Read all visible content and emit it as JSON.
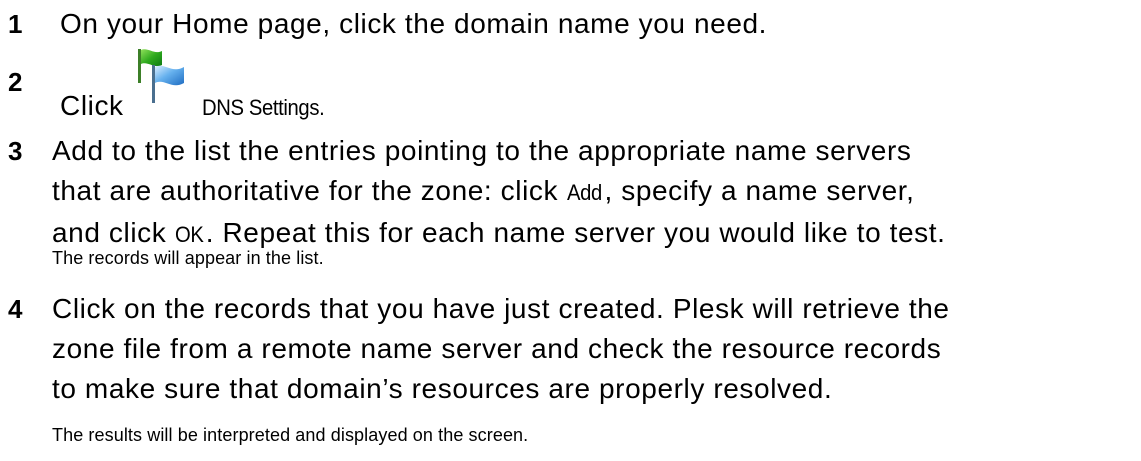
{
  "steps": [
    {
      "number": "1",
      "text": "On your Home page, click the domain name you need."
    },
    {
      "number": "2",
      "prefix": "Click",
      "icon": "dns-settings-flag-icon",
      "ui_label": "DNS Settings."
    },
    {
      "number": "3",
      "lines": [
        "Add to the list the entries pointing to the appropriate name servers",
        "that are authoritative for the zone: click ",
        "and click ",
        ". Repeat this for each name server you would like to test."
      ],
      "add_label": "Add",
      "after_add": ", specify a name server,",
      "ok_label": "OK",
      "note": "The records will appear in the list."
    },
    {
      "number": "4",
      "lines": [
        "Click on the records that you have just created. Plesk will retrieve the",
        "zone file from a remote name server and check the resource records",
        "to make sure that domain’s resources are properly resolved."
      ],
      "note": "The results will be interpreted and displayed on the screen."
    }
  ]
}
